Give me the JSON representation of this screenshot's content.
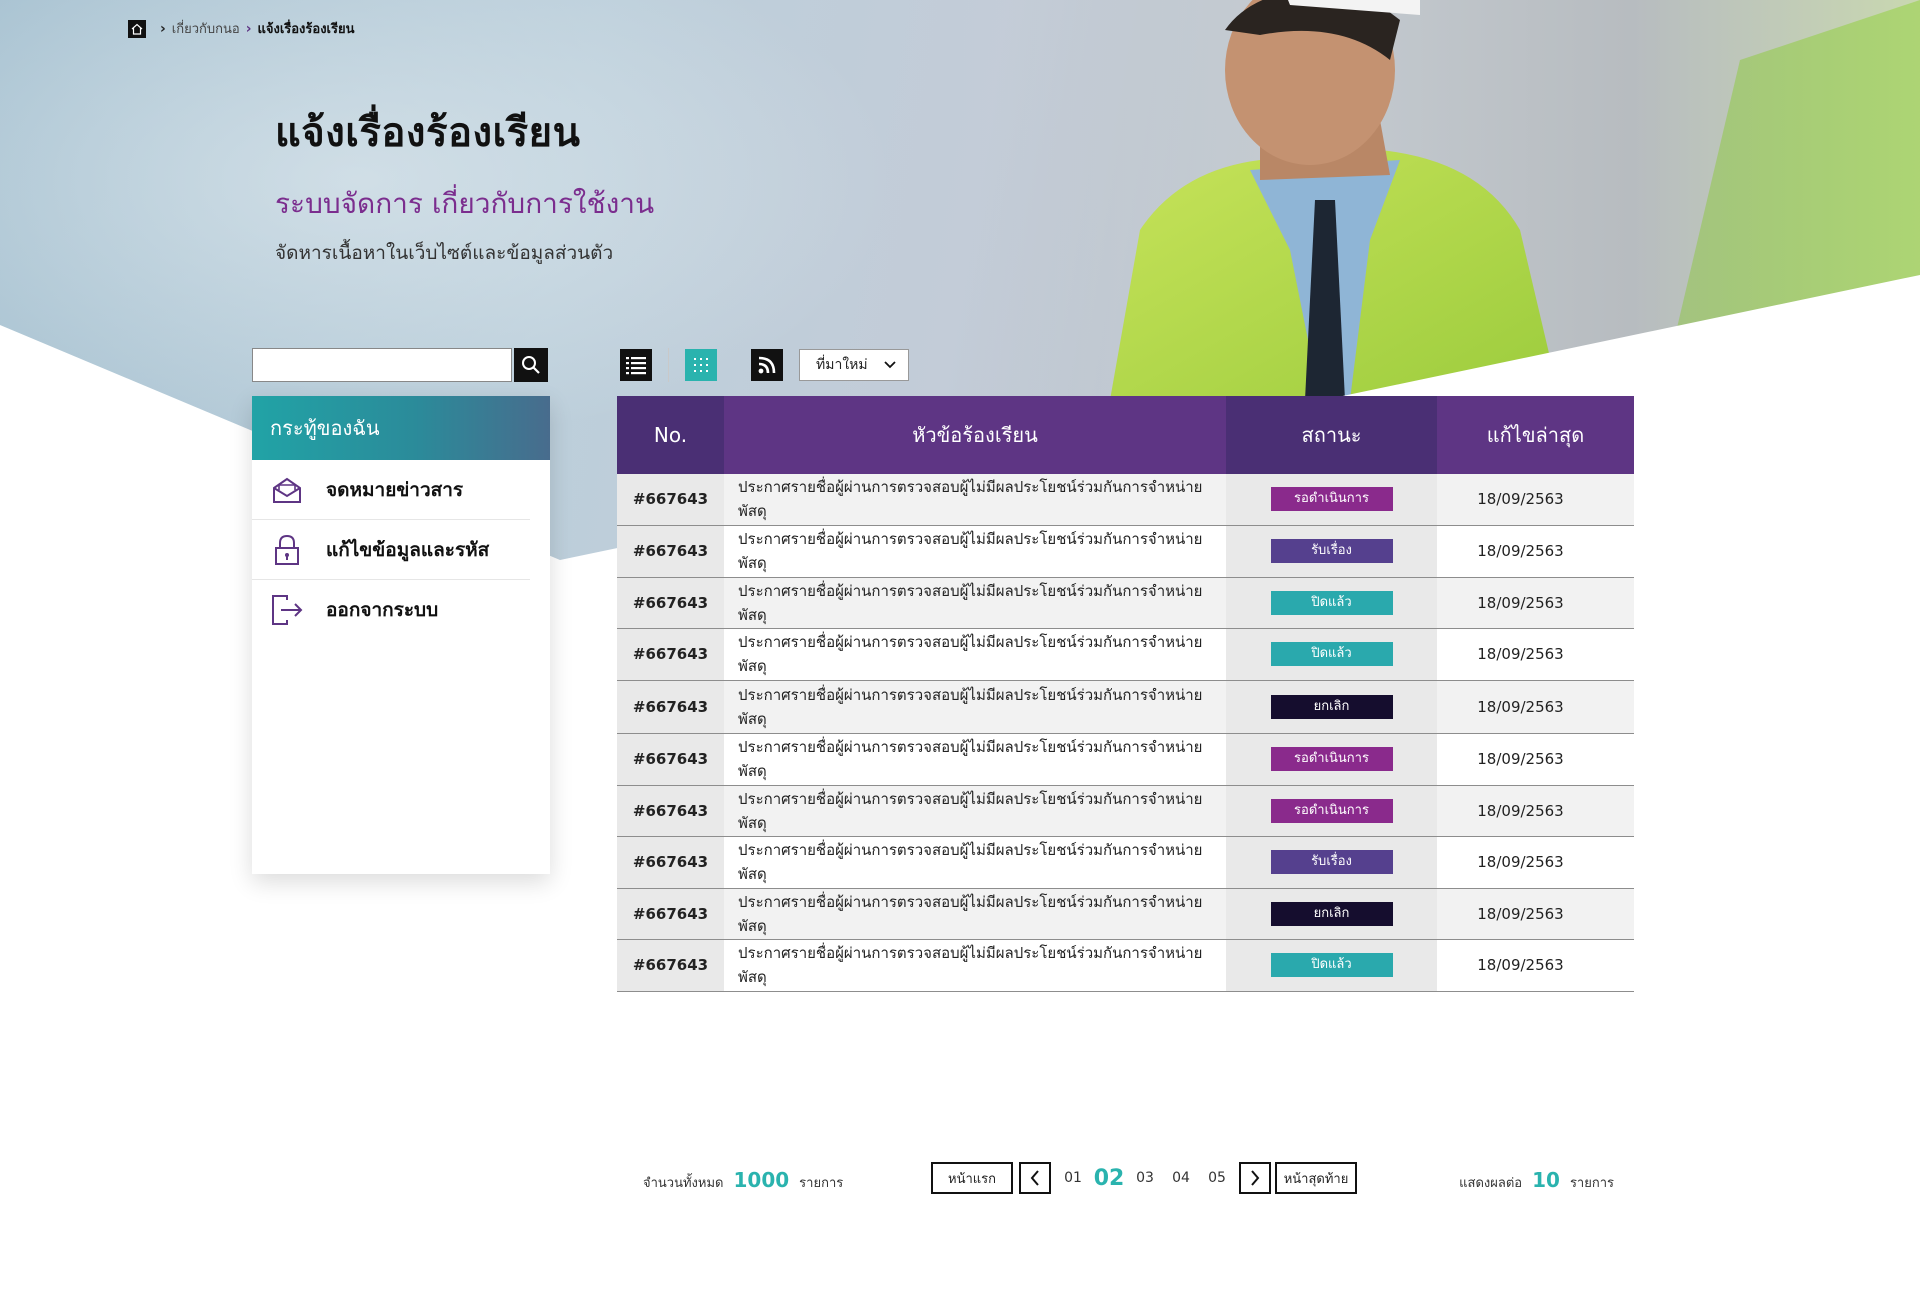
{
  "breadcrumb": {
    "items": [
      "เกี่ยวกับกนอ",
      "แจ้งเรื่องร้องเรียน"
    ]
  },
  "header": {
    "title": "แจ้งเรื่องร้องเรียน",
    "subtitle": "ระบบจัดการ เกี่ยวกับการใช้งาน",
    "description": "จัดหารเนื้อหาในเว็บไซต์และข้อมูลส่วนตัว"
  },
  "search": {
    "value": "",
    "placeholder": ""
  },
  "sidebar": {
    "title": "กระทู้ของฉัน",
    "items": [
      {
        "label": "จดหมายข่าวสาร",
        "icon": "envelope-open-icon"
      },
      {
        "label": "แก้ไขข้อมูลและรหัส",
        "icon": "lock-icon"
      },
      {
        "label": "ออกจากระบบ",
        "icon": "logout-icon"
      }
    ]
  },
  "toolbar": {
    "sort_label": "ที่มาใหม่"
  },
  "table": {
    "headers": {
      "no": "No.",
      "title": "หัวข้อร้องเรียน",
      "status": "สถานะ",
      "date": "แก้ไขล่าสุด"
    },
    "rows": [
      {
        "no": "#667643",
        "title": "ประกาศรายชื่อผู้ผ่านการตรวจสอบผู้ไม่มีผลประโยชน์ร่วมกันการจำหน่ายพัสดุ",
        "status": "รอดำเนินการ",
        "status_color": "#8a2a8c",
        "date": "18/09/2563"
      },
      {
        "no": "#667643",
        "title": "ประกาศรายชื่อผู้ผ่านการตรวจสอบผู้ไม่มีผลประโยชน์ร่วมกันการจำหน่ายพัสดุ",
        "status": "รับเรื่อง",
        "status_color": "#55408e",
        "date": "18/09/2563"
      },
      {
        "no": "#667643",
        "title": "ประกาศรายชื่อผู้ผ่านการตรวจสอบผู้ไม่มีผลประโยชน์ร่วมกันการจำหน่ายพัสดุ",
        "status": "ปิดแล้ว",
        "status_color": "#2aa9ad",
        "date": "18/09/2563"
      },
      {
        "no": "#667643",
        "title": "ประกาศรายชื่อผู้ผ่านการตรวจสอบผู้ไม่มีผลประโยชน์ร่วมกันการจำหน่ายพัสดุ",
        "status": "ปิดแล้ว",
        "status_color": "#2aa9ad",
        "date": "18/09/2563"
      },
      {
        "no": "#667643",
        "title": "ประกาศรายชื่อผู้ผ่านการตรวจสอบผู้ไม่มีผลประโยชน์ร่วมกันการจำหน่ายพัสดุ",
        "status": "ยกเลิก",
        "status_color": "#150d2e",
        "date": "18/09/2563"
      },
      {
        "no": "#667643",
        "title": "ประกาศรายชื่อผู้ผ่านการตรวจสอบผู้ไม่มีผลประโยชน์ร่วมกันการจำหน่ายพัสดุ",
        "status": "รอดำเนินการ",
        "status_color": "#8a2a8c",
        "date": "18/09/2563"
      },
      {
        "no": "#667643",
        "title": "ประกาศรายชื่อผู้ผ่านการตรวจสอบผู้ไม่มีผลประโยชน์ร่วมกันการจำหน่ายพัสดุ",
        "status": "รอดำเนินการ",
        "status_color": "#8a2a8c",
        "date": "18/09/2563"
      },
      {
        "no": "#667643",
        "title": "ประกาศรายชื่อผู้ผ่านการตรวจสอบผู้ไม่มีผลประโยชน์ร่วมกันการจำหน่ายพัสดุ",
        "status": "รับเรื่อง",
        "status_color": "#55408e",
        "date": "18/09/2563"
      },
      {
        "no": "#667643",
        "title": "ประกาศรายชื่อผู้ผ่านการตรวจสอบผู้ไม่มีผลประโยชน์ร่วมกันการจำหน่ายพัสดุ",
        "status": "ยกเลิก",
        "status_color": "#150d2e",
        "date": "18/09/2563"
      },
      {
        "no": "#667643",
        "title": "ประกาศรายชื่อผู้ผ่านการตรวจสอบผู้ไม่มีผลประโยชน์ร่วมกันการจำหน่ายพัสดุ",
        "status": "ปิดแล้ว",
        "status_color": "#2aa9ad",
        "date": "18/09/2563"
      }
    ]
  },
  "pagination": {
    "total_label": "จำนวนทั้งหมด",
    "total_count": "1000",
    "total_unit": "รายการ",
    "first_label": "หน้าแรก",
    "last_label": "หน้าสุดท้าย",
    "pages": [
      "01",
      "02",
      "03",
      "04",
      "05"
    ],
    "current_page": "02",
    "per_page_label": "แสดงผลต่อ",
    "per_page_count": "10",
    "per_page_unit": "รายการ"
  },
  "colors": {
    "accent_teal": "#2ab3ae",
    "header_purple_dark": "#4a2f74",
    "header_purple": "#5e3584",
    "subtitle_purple": "#7b2d8e"
  }
}
